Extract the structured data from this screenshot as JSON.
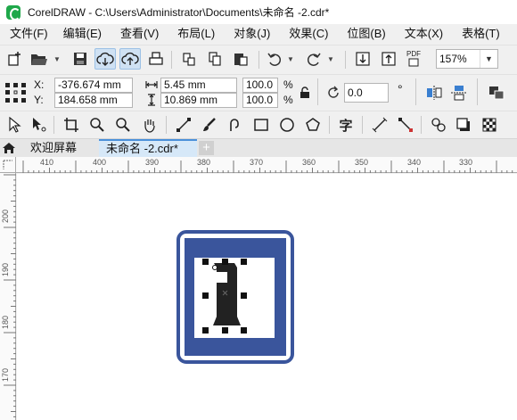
{
  "titlebar": {
    "title": "CorelDRAW - C:\\Users\\Administrator\\Documents\\未命名 -2.cdr*"
  },
  "menu": {
    "items": [
      {
        "label": "文件(F)"
      },
      {
        "label": "编辑(E)"
      },
      {
        "label": "查看(V)"
      },
      {
        "label": "布局(L)"
      },
      {
        "label": "对象(J)"
      },
      {
        "label": "效果(C)"
      },
      {
        "label": "位图(B)"
      },
      {
        "label": "文本(X)"
      },
      {
        "label": "表格(T)"
      }
    ]
  },
  "standard_toolbar": {
    "pdf_label": "PDF",
    "zoom_value": "157%"
  },
  "property_bar": {
    "x_label": "X:",
    "y_label": "Y:",
    "x_value": "-376.674 mm",
    "y_value": "184.658 mm",
    "width_value": "5.45 mm",
    "height_value": "10.869 mm",
    "scale_w": "100.0",
    "scale_h": "100.0",
    "percent": "%",
    "rotation": "0.0",
    "degree": "°"
  },
  "tools": {
    "text_tool_glyph": "字"
  },
  "tabs": {
    "welcome": "欢迎屏幕",
    "document": "未命名 -2.cdr*",
    "add": "+"
  },
  "rulers": {
    "horizontal": [
      "410",
      "400",
      "390",
      "380",
      "370",
      "360",
      "350",
      "340",
      "330"
    ],
    "vertical": [
      "200",
      "190",
      "180",
      "170"
    ]
  },
  "colors": {
    "sign_blue": "#3a559c",
    "accent": "#4a90d9"
  }
}
